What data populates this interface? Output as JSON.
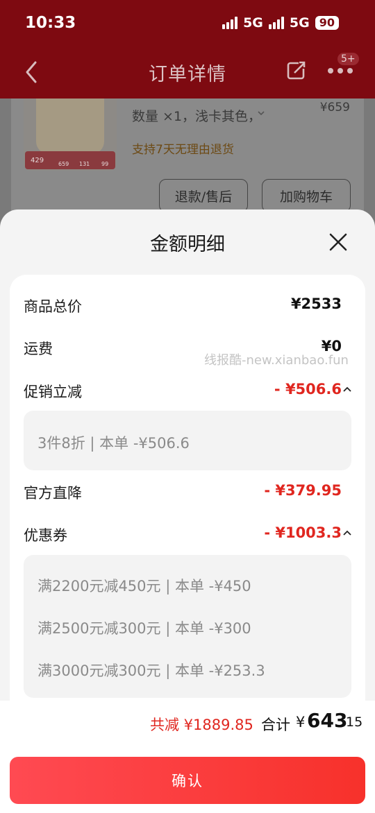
{
  "status_bar": {
    "time": "10:33",
    "network_1": "5G",
    "network_2": "5G",
    "battery": "90"
  },
  "nav": {
    "title": "订单详情",
    "more_badge": "5+"
  },
  "product": {
    "qty_text": "数量 ×1，浅卡其色，",
    "return_policy": "支持7天无理由退货",
    "price": "¥659",
    "thumb_price_1": "429",
    "thumb_price_2": "659",
    "thumb_price_3": "131",
    "thumb_price_4": "99"
  },
  "bg_buttons": {
    "refund": "退款/售后",
    "add_cart": "加购物车"
  },
  "sheet": {
    "title": "金额明细",
    "rows": {
      "goods_total": {
        "label": "商品总价",
        "value": "¥2533"
      },
      "shipping": {
        "label": "运费",
        "value": "¥0"
      },
      "promo": {
        "label": "促销立减",
        "value": "- ¥506.6"
      },
      "promo_detail": "3件8折 | 本单 -¥506.6",
      "official": {
        "label": "官方直降",
        "value": "- ¥379.95"
      },
      "coupon": {
        "label": "优惠券",
        "value": "- ¥1003.3"
      },
      "coupon_details": [
        "满2200元减450元 | 本单 -¥450",
        "满2500元减300元 | 本单 -¥300",
        "满3000元减300元 | 本单 -¥253.3"
      ]
    },
    "watermark": "线报酷-new.xianbao.fun"
  },
  "totals": {
    "reduce": "共减 ¥1889.85",
    "sum_label": "合计",
    "sum_symbol": "¥",
    "sum_int": "643",
    "sum_dec": ".15"
  },
  "confirm_label": "确认",
  "colors": {
    "header_bg": "#7e0a11",
    "accent_red": "#e0261f",
    "confirm_gradient_start": "#ff4a52",
    "confirm_gradient_end": "#f7312b"
  }
}
